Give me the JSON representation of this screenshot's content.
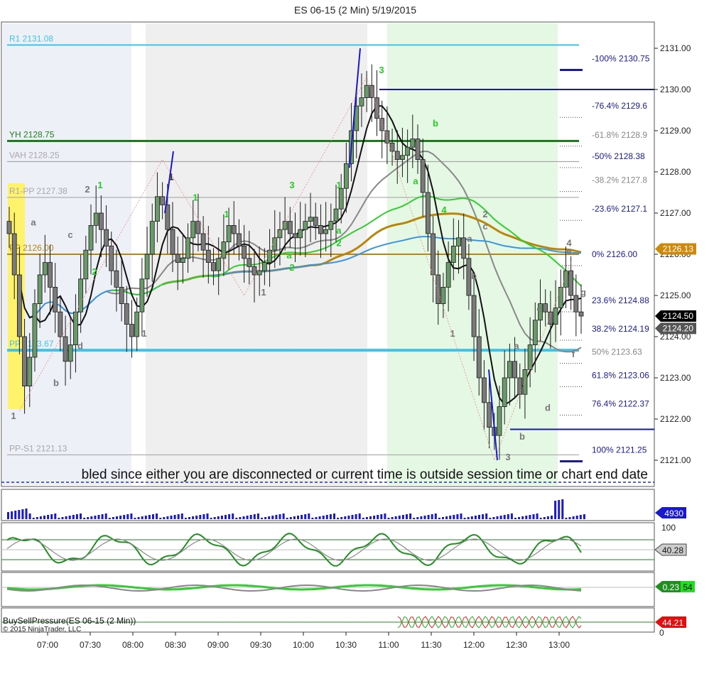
{
  "chart_data": {
    "type": "candlestick",
    "title": "ES 06-15 (2 Min)  5/19/2015",
    "copyright": "© 2015 NinjaTrader, LLC",
    "banner_text": "bled since either you are disconnected or current time is outside session time or chart end date",
    "price_axis": {
      "ylim": [
        2120.8,
        2131.4
      ],
      "ticks": [
        "2131.00",
        "2130.00",
        "2129.00",
        "2128.00",
        "2127.00",
        "2126.00",
        "2125.00",
        "2124.00",
        "2123.00",
        "2122.00",
        "2121.00"
      ],
      "current_price": "2124.50",
      "markers": [
        {
          "label": "2126.13",
          "price": 2126.13,
          "color": "#cd8a0a"
        },
        {
          "label": "2124.50",
          "price": 2124.5,
          "color": "#000000"
        },
        {
          "label": "2124.20",
          "price": 2124.2,
          "color": "#555555"
        }
      ]
    },
    "time_axis": {
      "ticks": [
        "07:00",
        "07:30",
        "08:00",
        "08:30",
        "09:00",
        "09:30",
        "10:00",
        "10:30",
        "11:00",
        "11:30",
        "12:00",
        "12:30",
        "13:00"
      ]
    },
    "pivot_levels": [
      {
        "label": "R1 2131.08",
        "price": 2131.08,
        "color": "#3fc4e8"
      },
      {
        "label": "YH 2128.75",
        "price": 2128.75,
        "color": "#1f7a1f"
      },
      {
        "label": "VAH 2128.25",
        "price": 2128.25,
        "color": "#a8a8a8"
      },
      {
        "label": "R1-PP 2127.38",
        "price": 2127.38,
        "color": "#a8a8a8"
      },
      {
        "label": "PP 2126.00",
        "price": 2126.0,
        "color": "#b8860b"
      },
      {
        "label": "PP 2123.67",
        "price": 2123.67,
        "color": "#3fc4e8"
      },
      {
        "label": "PP-S1 2121.13",
        "price": 2121.13,
        "color": "#a8a8a8"
      }
    ],
    "fib_levels": [
      {
        "label": "-100%  2130.75",
        "price": 2130.75
      },
      {
        "label": "-76.4%  2129.6",
        "price": 2129.6
      },
      {
        "label": "-61.8%  2128.9",
        "price": 2128.9
      },
      {
        "label": "-50%  2128.38",
        "price": 2128.38
      },
      {
        "label": "-38.2%  2127.8",
        "price": 2127.8
      },
      {
        "label": "-23.6%  2127.1",
        "price": 2127.1
      },
      {
        "label": "0%  2126.00",
        "price": 2126.0
      },
      {
        "label": "23.6%  2124.88",
        "price": 2124.88
      },
      {
        "label": "38.2%  2124.19",
        "price": 2124.19
      },
      {
        "label": "50%  2123.63",
        "price": 2123.63
      },
      {
        "label": "61.8%  2123.06",
        "price": 2123.06
      },
      {
        "label": "76.4%  2122.37",
        "price": 2122.37
      },
      {
        "label": "100%  2121.25",
        "price": 2121.25
      }
    ],
    "wave_labels": [
      {
        "text": "1",
        "t": 0.3,
        "price": 2122.0,
        "color": "#777777"
      },
      {
        "text": "a",
        "t": 1.7,
        "price": 2126.7,
        "color": "#777777"
      },
      {
        "text": "b",
        "t": 3.3,
        "price": 2122.8,
        "color": "#777777"
      },
      {
        "text": "c",
        "t": 4.3,
        "price": 2126.4,
        "color": "#777777"
      },
      {
        "text": "d",
        "t": 5.0,
        "price": 2123.7,
        "color": "#777777"
      },
      {
        "text": "2",
        "t": 5.5,
        "price": 2127.5,
        "color": "#777777"
      },
      {
        "text": "1",
        "t": 6.4,
        "price": 2127.6,
        "color": "#22cc22"
      },
      {
        "text": "2",
        "t": 6.0,
        "price": 2125.5,
        "color": "#22cc22"
      },
      {
        "text": "1",
        "t": 9.5,
        "price": 2124.0,
        "color": "#777777"
      },
      {
        "text": "1",
        "t": 11.4,
        "price": 2127.8,
        "color": "#222222"
      },
      {
        "text": "1",
        "t": 13.1,
        "price": 2127.3,
        "color": "#22cc22"
      },
      {
        "text": "1",
        "t": 15.3,
        "price": 2126.9,
        "color": "#22cc22"
      },
      {
        "text": "1",
        "t": 17.9,
        "price": 2125.0,
        "color": "#777777"
      },
      {
        "text": "3",
        "t": 19.9,
        "price": 2127.6,
        "color": "#22cc22"
      },
      {
        "text": "a",
        "t": 19.7,
        "price": 2125.9,
        "color": "#22cc22"
      },
      {
        "text": "2",
        "t": 19.9,
        "price": 2125.6,
        "color": "#22cc22"
      },
      {
        "text": "1",
        "t": 23.2,
        "price": 2127.6,
        "color": "#22cc22"
      },
      {
        "text": "a",
        "t": 23.2,
        "price": 2126.5,
        "color": "#22cc22"
      },
      {
        "text": "2",
        "t": 23.2,
        "price": 2126.2,
        "color": "#22cc22"
      },
      {
        "text": "3",
        "t": 26.2,
        "price": 2130.4,
        "color": "#22cc22"
      },
      {
        "text": "a",
        "t": 28.6,
        "price": 2127.7,
        "color": "#22cc22"
      },
      {
        "text": "b",
        "t": 30.0,
        "price": 2129.1,
        "color": "#22cc22"
      },
      {
        "text": "4",
        "t": 30.6,
        "price": 2127.0,
        "color": "#22cc22"
      },
      {
        "text": "1",
        "t": 31.2,
        "price": 2124.0,
        "color": "#777777"
      },
      {
        "text": "a",
        "t": 32.4,
        "price": 2126.3,
        "color": "#777777"
      },
      {
        "text": "b",
        "t": 32.7,
        "price": 2125.4,
        "color": "#777777"
      },
      {
        "text": "2",
        "t": 33.5,
        "price": 2126.9,
        "color": "#777777"
      },
      {
        "text": "c",
        "t": 33.5,
        "price": 2126.6,
        "color": "#777777"
      },
      {
        "text": "3",
        "t": 35.1,
        "price": 2121.0,
        "color": "#777777"
      },
      {
        "text": "a",
        "t": 35.7,
        "price": 2123.7,
        "color": "#777777"
      },
      {
        "text": "b",
        "t": 36.1,
        "price": 2121.5,
        "color": "#777777"
      },
      {
        "text": "c",
        "t": 37.3,
        "price": 2124.6,
        "color": "#777777"
      },
      {
        "text": "d",
        "t": 37.9,
        "price": 2122.2,
        "color": "#777777"
      },
      {
        "text": "4",
        "t": 39.4,
        "price": 2126.2,
        "color": "#777777"
      },
      {
        "text": "e",
        "t": 39.4,
        "price": 2126.0,
        "color": "#777777"
      },
      {
        "text": "f",
        "t": 39.7,
        "price": 2123.5,
        "color": "#777777"
      },
      {
        "text": "g",
        "t": 40.4,
        "price": 2125.0,
        "color": "#777777"
      }
    ],
    "volume_panel": {
      "marker": "4930"
    },
    "stochastic_panel": {
      "scale_top": "100",
      "value": "40.28"
    },
    "momentum_panel": {
      "value_a": "0.23",
      "value_b": "54"
    },
    "buysell_panel": {
      "title": "BuySellPressure(ES 06-15 (2 Min))",
      "value": "44.21",
      "scale_bottom": "0"
    },
    "colors": {
      "up_candle": "#6a9a6a",
      "down_candle": "#7a7a7a",
      "wick": "#1a1a1a",
      "session_zone_a": "#eef0f8",
      "session_zone_b": "#efefef",
      "session_zone_c": "#e4f8e4",
      "opening_zone": "#fff36b",
      "sma_fast": "#111111",
      "sma_mid": "#888888",
      "ema_green": "#33cc33",
      "ma_gold": "#b8860b",
      "ma_blue": "#3a95e0",
      "fib_line": "#1a1a9a"
    }
  }
}
